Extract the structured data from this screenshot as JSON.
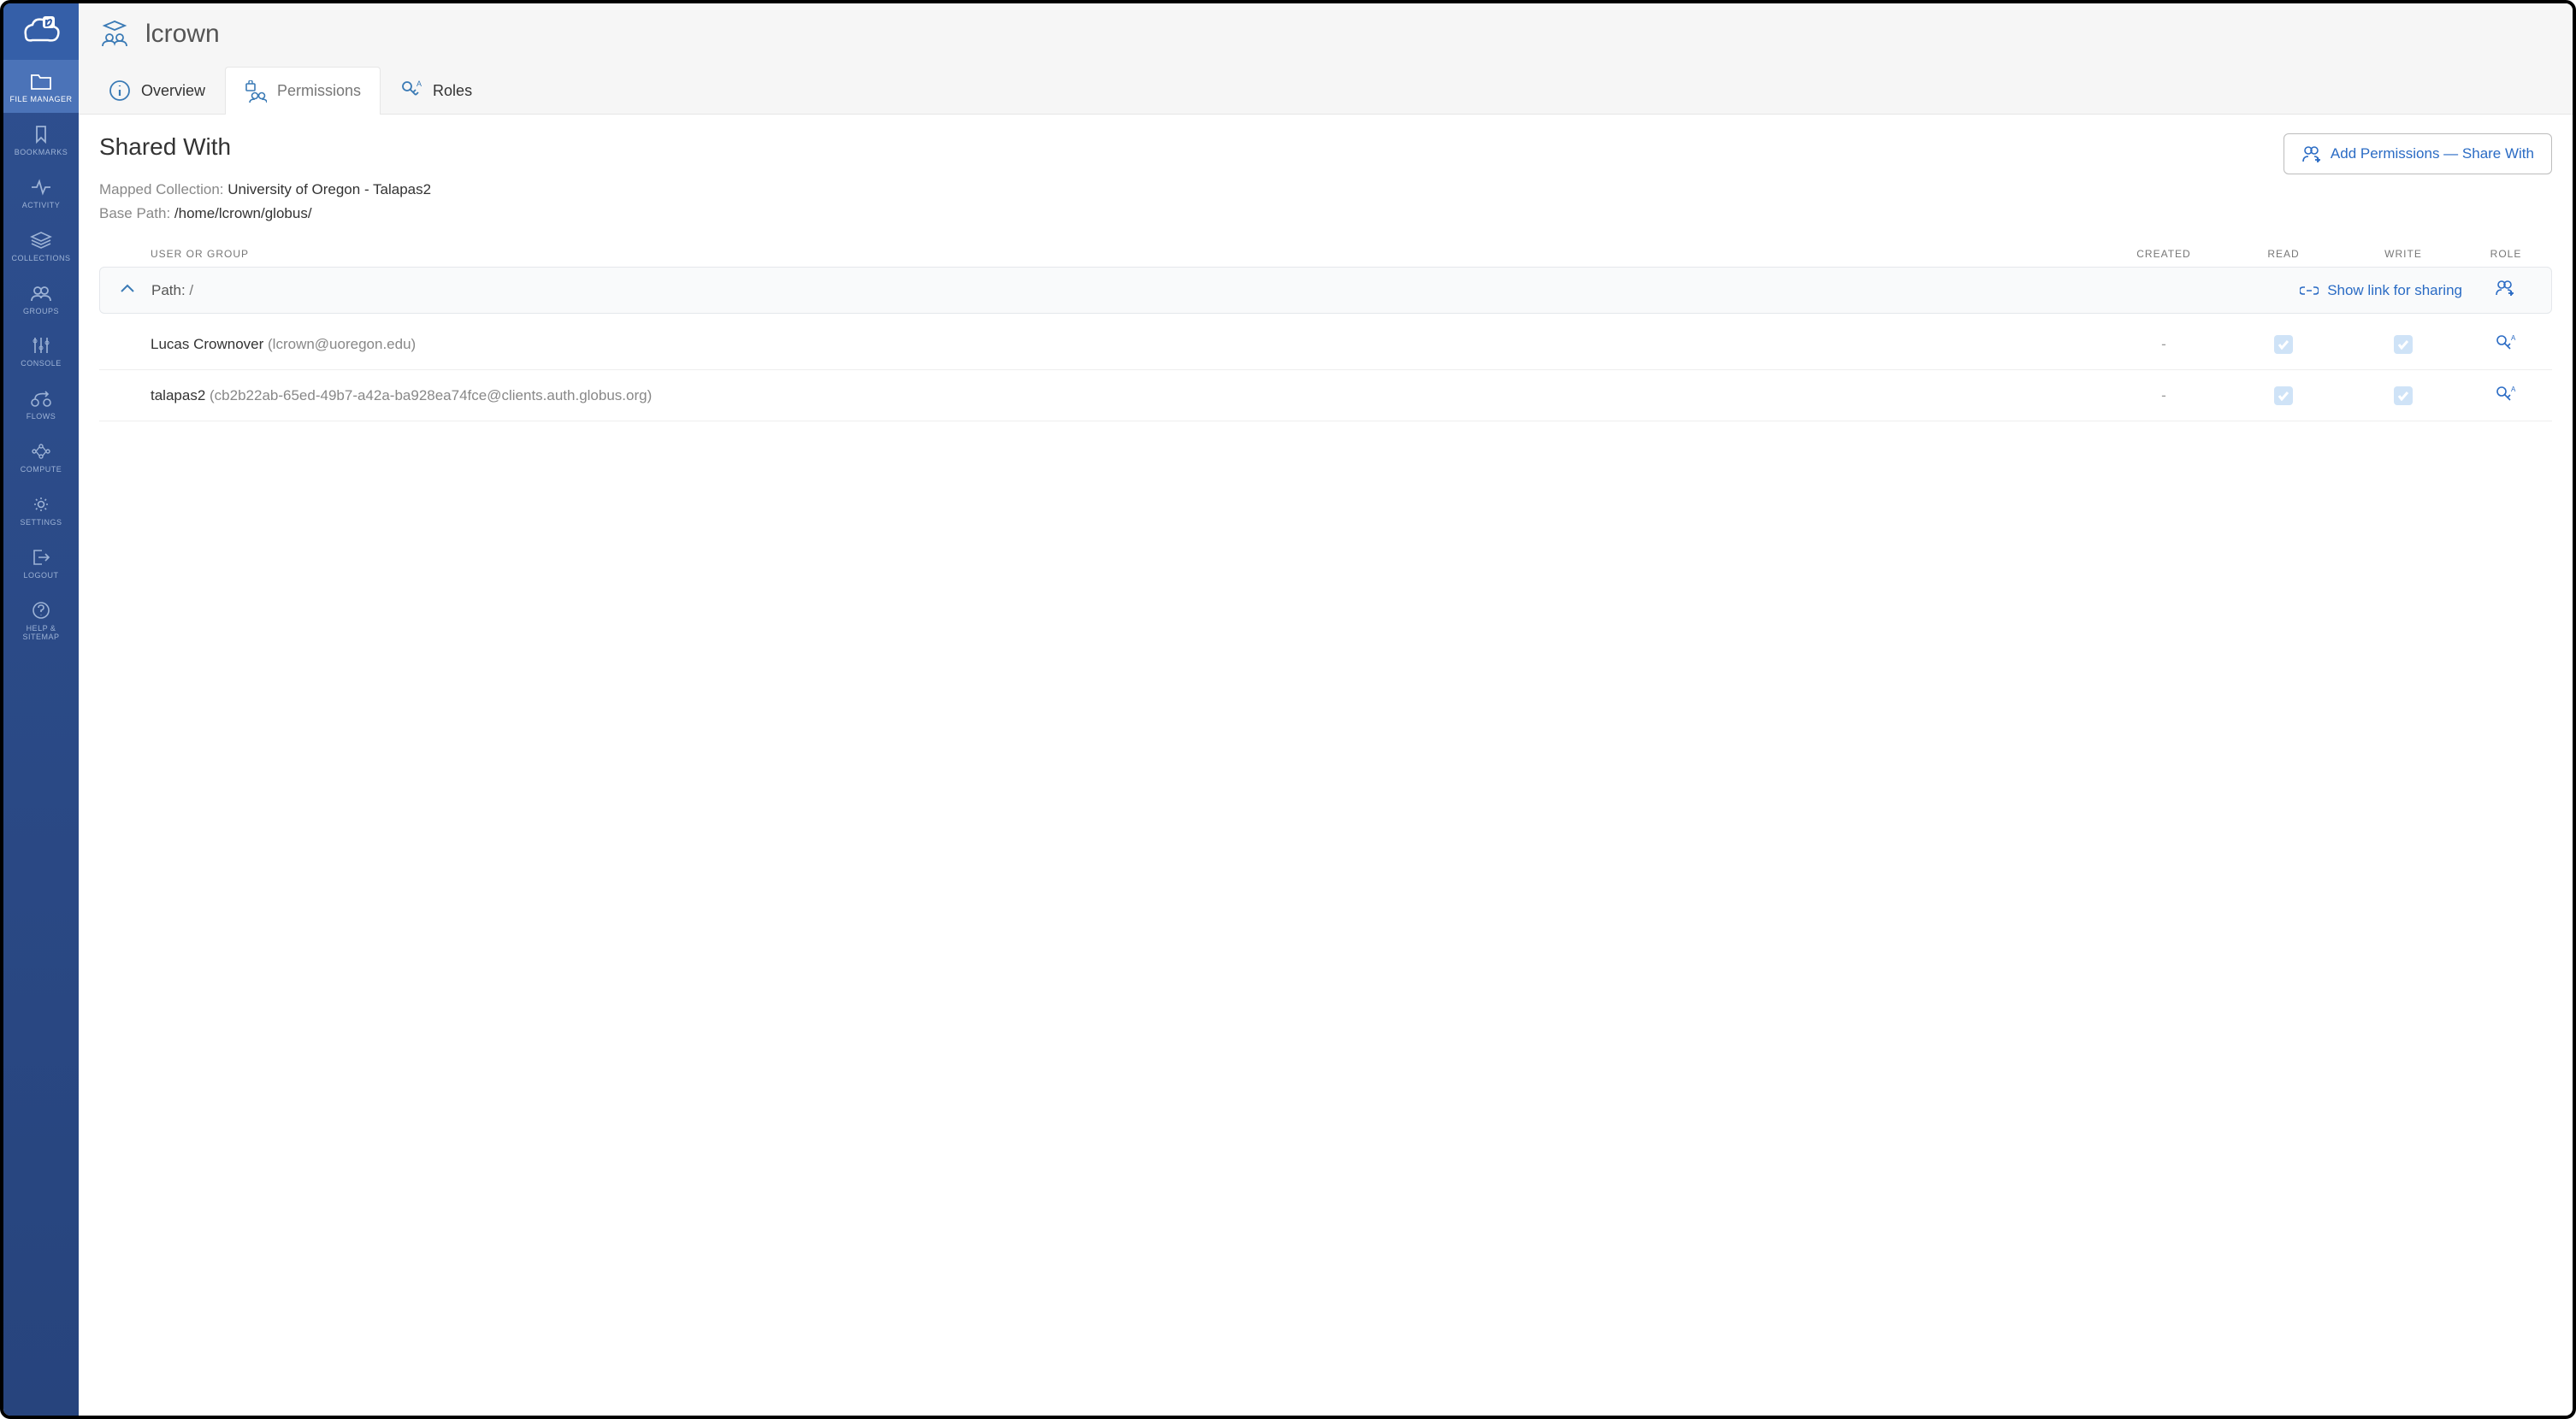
{
  "sidebar": {
    "items": [
      {
        "label": "FILE MANAGER"
      },
      {
        "label": "BOOKMARKS"
      },
      {
        "label": "ACTIVITY"
      },
      {
        "label": "COLLECTIONS"
      },
      {
        "label": "GROUPS"
      },
      {
        "label": "CONSOLE"
      },
      {
        "label": "FLOWS"
      },
      {
        "label": "COMPUTE"
      },
      {
        "label": "SETTINGS"
      },
      {
        "label": "LOGOUT"
      },
      {
        "label": "HELP & SITEMAP"
      }
    ]
  },
  "header": {
    "title": "lcrown"
  },
  "tabs": [
    {
      "label": "Overview"
    },
    {
      "label": "Permissions"
    },
    {
      "label": "Roles"
    }
  ],
  "section": {
    "title": "Shared With",
    "add_button": "Add Permissions — Share With",
    "mapped_label": "Mapped Collection:",
    "mapped_value": "University of Oregon - Talapas2",
    "basepath_label": "Base Path:",
    "basepath_value": "/home/lcrown/globus/"
  },
  "table": {
    "cols": {
      "user": "USER OR GROUP",
      "created": "CREATED",
      "read": "READ",
      "write": "WRITE",
      "role": "ROLE"
    },
    "path_row": {
      "label": "Path: ",
      "value": "/",
      "share": "Show link for sharing"
    },
    "rows": [
      {
        "name": "Lucas Crownover",
        "id": "(lcrown@uoregon.edu)",
        "created": "-"
      },
      {
        "name": "talapas2",
        "id": "(cb2b22ab-65ed-49b7-a42a-ba928ea74fce@clients.auth.globus.org)",
        "created": "-"
      }
    ]
  }
}
